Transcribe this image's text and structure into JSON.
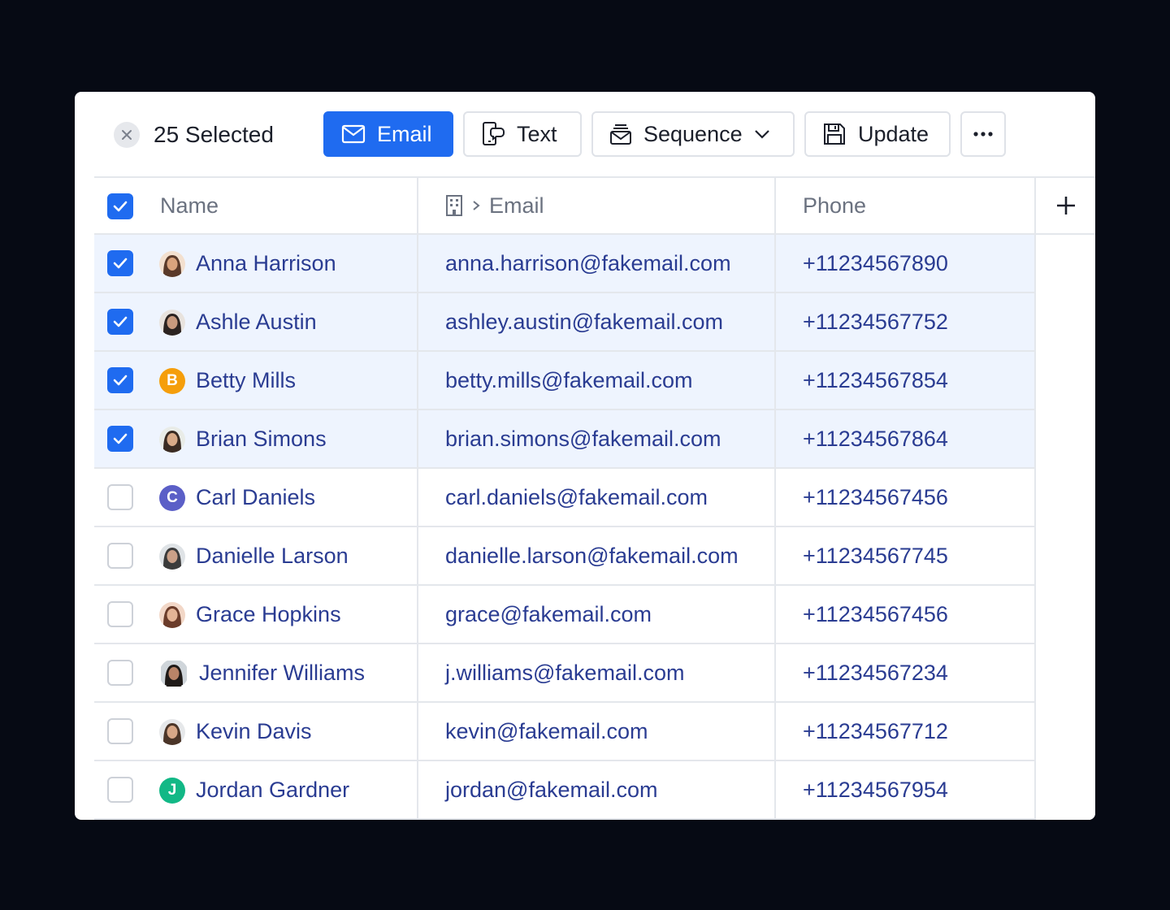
{
  "toolbar": {
    "selected_label": "25 Selected",
    "email_label": "Email",
    "text_label": "Text",
    "sequence_label": "Sequence",
    "update_label": "Update"
  },
  "columns": {
    "name": "Name",
    "email": "Email",
    "phone": "Phone"
  },
  "colors": {
    "primary": "#1f6bf0",
    "link_text": "#2a3c92",
    "selected_row": "#eef4fe"
  },
  "rows": [
    {
      "name": "Anna Harrison",
      "email": "anna.harrison@fakemail.com",
      "phone": "+11234567890",
      "checked": true,
      "avatar": "photo"
    },
    {
      "name": "Ashle Austin",
      "email": "ashley.austin@fakemail.com",
      "phone": "+11234567752",
      "checked": true,
      "avatar": "photo"
    },
    {
      "name": "Betty Mills",
      "email": "betty.mills@fakemail.com",
      "phone": "+11234567854",
      "checked": true,
      "avatar": "B",
      "avatar_color": "#f59e0b"
    },
    {
      "name": "Brian Simons",
      "email": "brian.simons@fakemail.com",
      "phone": "+11234567864",
      "checked": true,
      "avatar": "photo"
    },
    {
      "name": "Carl Daniels",
      "email": "carl.daniels@fakemail.com",
      "phone": "+11234567456",
      "checked": false,
      "avatar": "C",
      "avatar_color": "#5b5fc7"
    },
    {
      "name": "Danielle Larson",
      "email": "danielle.larson@fakemail.com",
      "phone": "+11234567745",
      "checked": false,
      "avatar": "photo"
    },
    {
      "name": "Grace Hopkins",
      "email": "grace@fakemail.com",
      "phone": "+11234567456",
      "checked": false,
      "avatar": "photo"
    },
    {
      "name": "Jennifer Williams",
      "email": "j.williams@fakemail.com",
      "phone": "+11234567234",
      "checked": false,
      "avatar": "photo"
    },
    {
      "name": "Kevin Davis",
      "email": "kevin@fakemail.com",
      "phone": "+11234567712",
      "checked": false,
      "avatar": "photo"
    },
    {
      "name": "Jordan Gardner",
      "email": "jordan@fakemail.com",
      "phone": "+11234567954",
      "checked": false,
      "avatar": "J",
      "avatar_color": "#12b886"
    }
  ]
}
